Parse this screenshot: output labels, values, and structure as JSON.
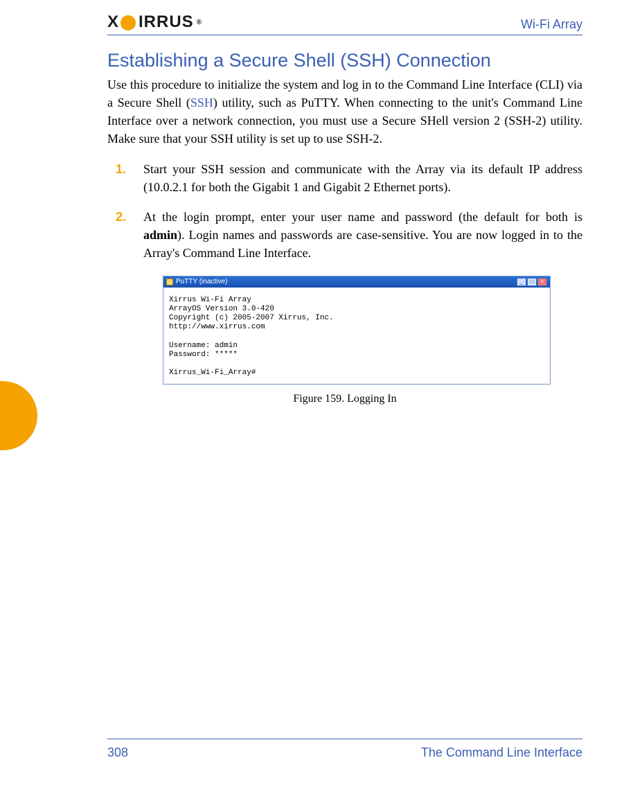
{
  "header": {
    "logo_text": "IRRUS",
    "product": "Wi-Fi Array"
  },
  "title": "Establishing a Secure Shell (SSH) Connection",
  "intro": {
    "pre": "Use this procedure to initialize the system and log in to the Command Line Interface (CLI) via a Secure Shell (",
    "link": "SSH",
    "post": ") utility, such as PuTTY. When connecting to the unit's Command Line Interface over a network connection, you must use a Secure SHell version 2 (SSH-2) utility. Make sure that your SSH utility is set up to use SSH-2."
  },
  "steps": [
    {
      "marker": "1.",
      "text": "Start your SSH session and communicate with the Array via its default IP address (10.0.2.1 for both the Gigabit 1 and Gigabit 2 Ethernet ports)."
    },
    {
      "marker": "2.",
      "pre": "At the login prompt, enter your user name and password (the default for both is ",
      "bold": "admin",
      "post": "). Login names and passwords are case-sensitive. You are now logged in to the Array's Command Line Interface."
    }
  ],
  "putty": {
    "title": "PuTTY (inactive)",
    "body": "Xirrus Wi-Fi Array\nArrayOS Version 3.0-420\nCopyright (c) 2005-2007 Xirrus, Inc.\nhttp://www.xirrus.com\n\nUsername: admin\nPassword: *****\n\nXirrus_Wi-Fi_Array#"
  },
  "figure_caption": "Figure 159. Logging In",
  "footer": {
    "page": "308",
    "section": "The Command Line Interface"
  },
  "window_buttons": {
    "min": "_",
    "max": "□",
    "close": "×"
  }
}
